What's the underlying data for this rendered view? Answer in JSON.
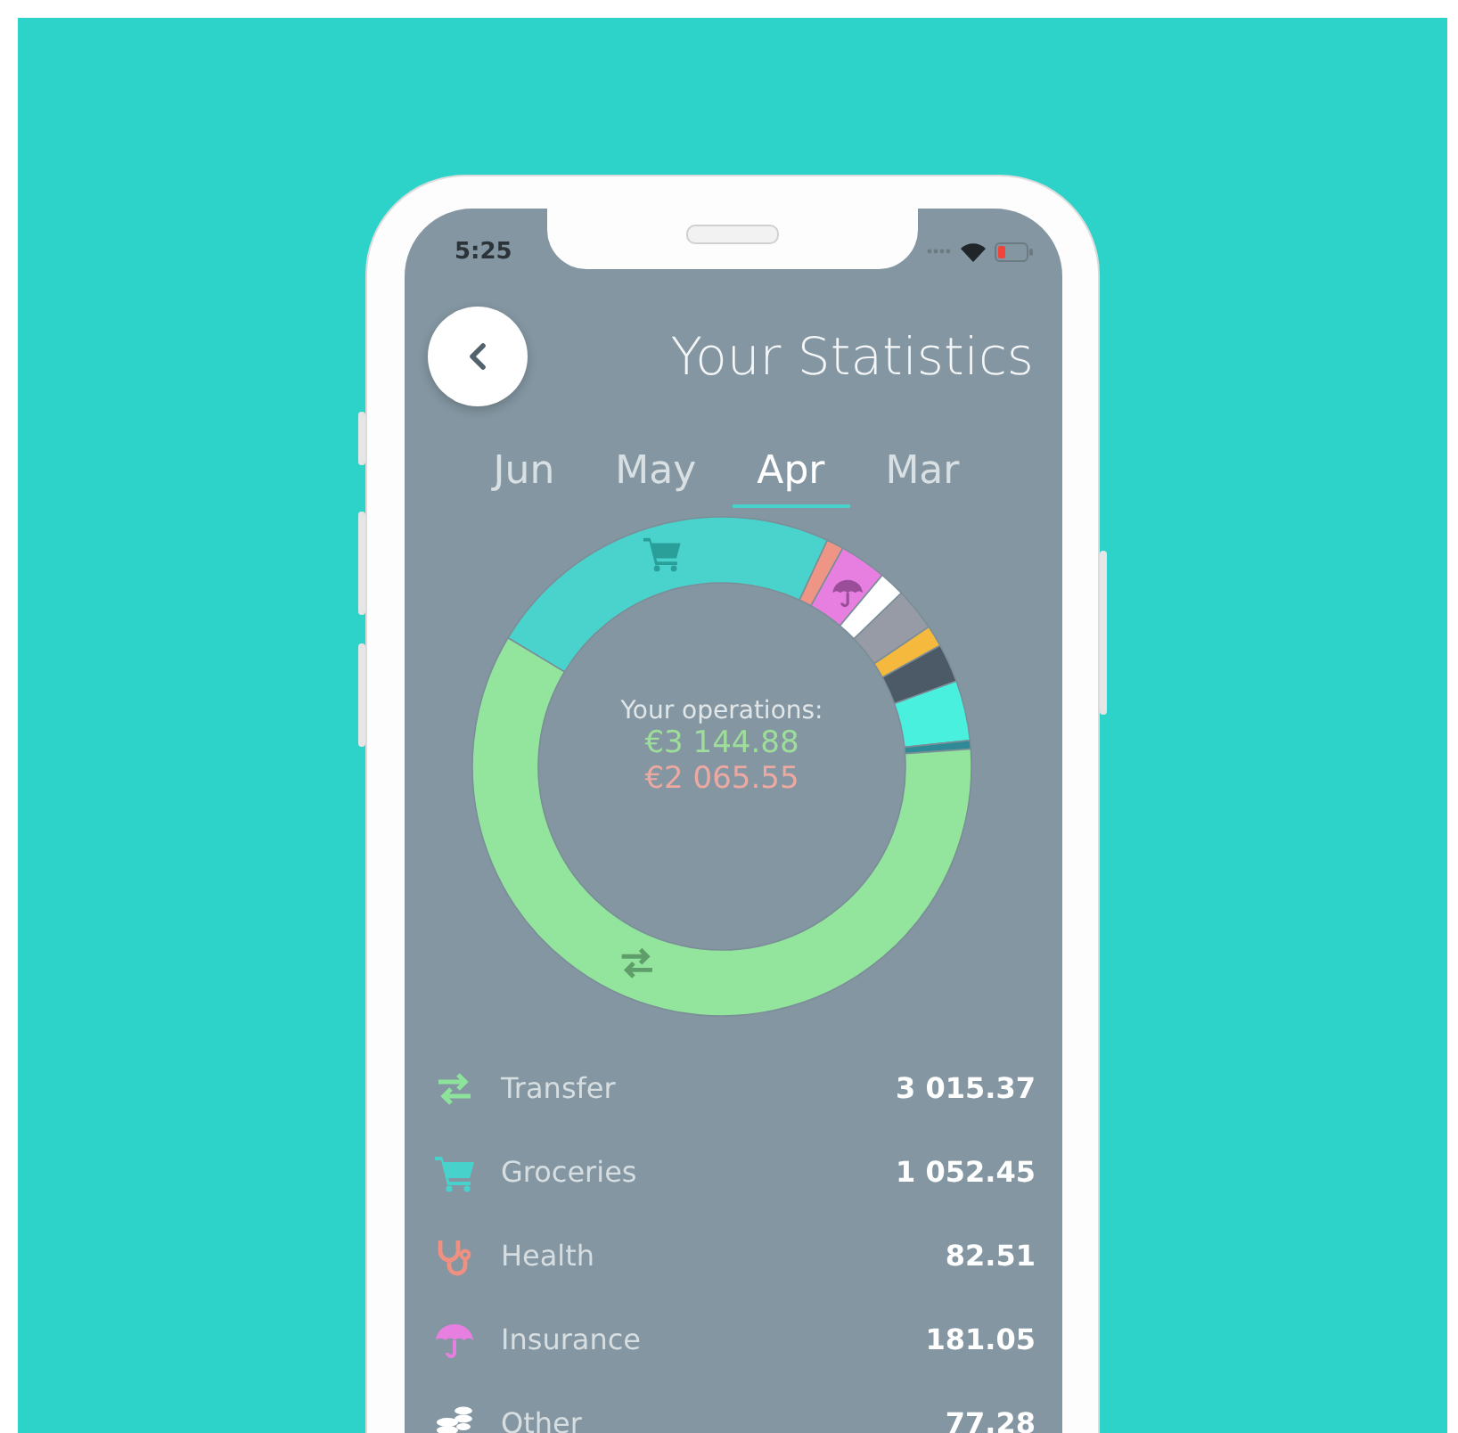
{
  "status_bar": {
    "time": "5:25"
  },
  "header": {
    "title": "Your Statistics"
  },
  "tabs": [
    {
      "label": "Jun",
      "selected": false
    },
    {
      "label": "May",
      "selected": false
    },
    {
      "label": "Apr",
      "selected": true
    },
    {
      "label": "Mar",
      "selected": false
    }
  ],
  "summary": {
    "caption": "Your operations:",
    "income": "€3 144.88",
    "expenses": "€2 065.55"
  },
  "categories": [
    {
      "kind": "transfer",
      "label": "Transfer",
      "amount": "3 015.37",
      "color": "#8de39b"
    },
    {
      "kind": "groceries",
      "label": "Groceries",
      "amount": "1 052.45",
      "color": "#47d3cc"
    },
    {
      "kind": "health",
      "label": "Health",
      "amount": "82.51",
      "color": "#f09080"
    },
    {
      "kind": "insurance",
      "label": "Insurance",
      "amount": "181.05",
      "color": "#e67fe0"
    },
    {
      "kind": "other",
      "label": "Other",
      "amount": "77.28",
      "color": "#ffffff"
    }
  ]
}
